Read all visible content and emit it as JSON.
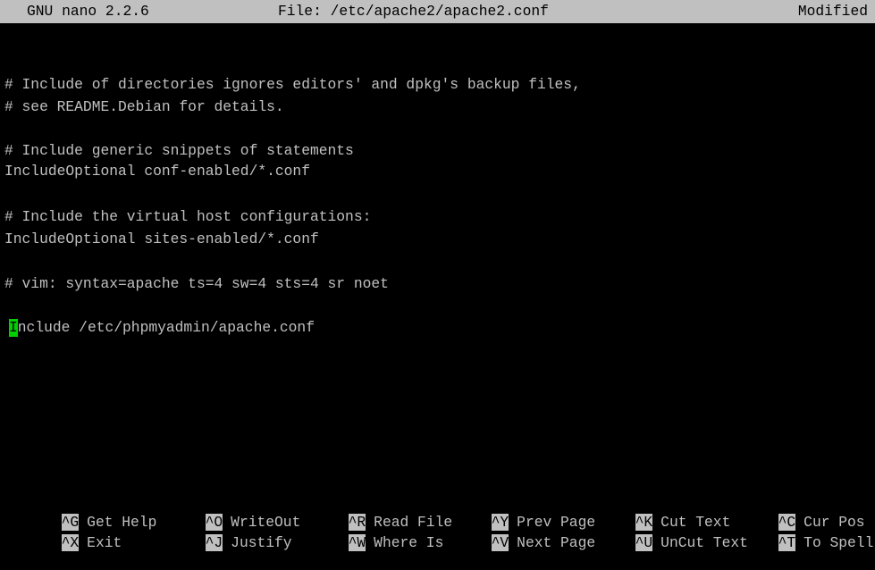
{
  "titlebar": {
    "app": "GNU nano 2.2.6",
    "file": "File: /etc/apache2/apache2.conf",
    "status": "Modified"
  },
  "editor": {
    "lines": [
      "# Include of directories ignores editors' and dpkg's backup files,",
      "# see README.Debian for details.",
      "# Include generic snippets of statements",
      "IncludeOptional conf-enabled/*.conf",
      "# Include the virtual host configurations:",
      "IncludeOptional sites-enabled/*.conf",
      "# vim: syntax=apache ts=4 sw=4 sts=4 sr noet"
    ],
    "cursor_line": {
      "cursor_char": "I",
      "rest": "nclude /etc/phpmyadmin/apache.conf"
    }
  },
  "shortcuts": {
    "row1": [
      {
        "key": "^G",
        "label": "Get Help"
      },
      {
        "key": "^O",
        "label": "WriteOut"
      },
      {
        "key": "^R",
        "label": "Read File"
      },
      {
        "key": "^Y",
        "label": "Prev Page"
      },
      {
        "key": "^K",
        "label": "Cut Text"
      },
      {
        "key": "^C",
        "label": "Cur Pos"
      }
    ],
    "row2": [
      {
        "key": "^X",
        "label": "Exit"
      },
      {
        "key": "^J",
        "label": "Justify"
      },
      {
        "key": "^W",
        "label": "Where Is"
      },
      {
        "key": "^V",
        "label": "Next Page"
      },
      {
        "key": "^U",
        "label": "UnCut Text"
      },
      {
        "key": "^T",
        "label": "To Spell"
      }
    ]
  },
  "colors": {
    "background": "#000000",
    "foreground": "#c0c0c0",
    "titlebar_bg": "#c0c0c0",
    "cursor": "#00d000"
  }
}
